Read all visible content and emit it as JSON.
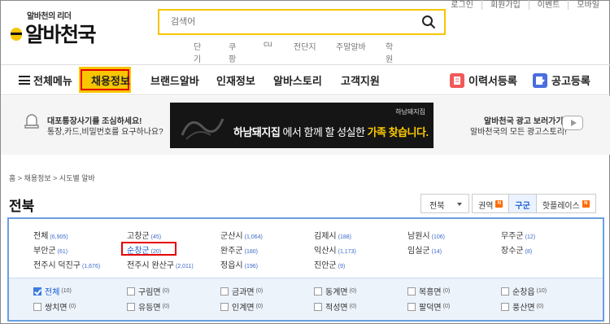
{
  "util": [
    "로그인",
    "회원가입",
    "이벤트",
    "모바일"
  ],
  "logo": {
    "tagline": "알바천의 리더",
    "name": "알바천국"
  },
  "search": {
    "placeholder": "검색어"
  },
  "keywords": [
    "단기",
    "쿠팡",
    "cu",
    "전단지",
    "주말알바",
    "학원"
  ],
  "nav": {
    "menu": "전체메뉴",
    "items": [
      "채용정보",
      "브랜드알바",
      "인재정보",
      "알바스토리",
      "고객지원"
    ],
    "resume": "이력서등록",
    "post": "공고등록"
  },
  "banner": {
    "warn1": "대포통장사기를 조심하세요!",
    "warn2": "통장,카드,비밀번호를 요구하나요?",
    "ad_brand": "하남돼지집",
    "ad_text_a": "하남돼지집",
    "ad_text_b": "에서 함께 할 성실한",
    "ad_text_c": "가족 찾습니다.",
    "promo1": "알바천국 광고 보러가기",
    "promo2": "알바천국의 모든 광고스토리!"
  },
  "breadcrumb": "홈 > 채용정보 > 시도별 알바",
  "title": "전북",
  "select": "전북",
  "tabs": [
    {
      "label": "권역",
      "badge": "N"
    },
    {
      "label": "구군",
      "badge": ""
    },
    {
      "label": "핫플레이스",
      "badge": "N"
    }
  ],
  "regions": [
    {
      "name": "전체",
      "count": "(6,905)"
    },
    {
      "name": "고창군",
      "count": "(45)"
    },
    {
      "name": "군산시",
      "count": "(1,064)"
    },
    {
      "name": "김제시",
      "count": "(188)"
    },
    {
      "name": "남원시",
      "count": "(106)"
    },
    {
      "name": "무주군",
      "count": "(12)"
    },
    {
      "name": "부안군",
      "count": "(61)"
    },
    {
      "name": "순창군",
      "count": "(20)"
    },
    {
      "name": "완주군",
      "count": "(180)"
    },
    {
      "name": "익산시",
      "count": "(1,173)"
    },
    {
      "name": "임실군",
      "count": "(14)"
    },
    {
      "name": "장수군",
      "count": "(8)"
    },
    {
      "name": "전주시 덕진구",
      "count": "(1,676)"
    },
    {
      "name": "전주시 완산구",
      "count": "(2,011)"
    },
    {
      "name": "정읍시",
      "count": "(196)"
    },
    {
      "name": "진안군",
      "count": "(9)"
    }
  ],
  "subregions": [
    {
      "name": "전체",
      "count": "(10)",
      "checked": true
    },
    {
      "name": "구림면",
      "count": "(0)",
      "checked": false
    },
    {
      "name": "금과면",
      "count": "(0)",
      "checked": false
    },
    {
      "name": "동계면",
      "count": "(0)",
      "checked": false
    },
    {
      "name": "복흥면",
      "count": "(0)",
      "checked": false
    },
    {
      "name": "순창읍",
      "count": "(10)",
      "checked": false
    },
    {
      "name": "쌍치면",
      "count": "(0)",
      "checked": false
    },
    {
      "name": "유등면",
      "count": "(0)",
      "checked": false
    },
    {
      "name": "인계면",
      "count": "(0)",
      "checked": false
    },
    {
      "name": "적성면",
      "count": "(0)",
      "checked": false
    },
    {
      "name": "팔덕면",
      "count": "(0)",
      "checked": false
    },
    {
      "name": "풍산면",
      "count": "(0)",
      "checked": false
    }
  ],
  "colors": {
    "brand": "#f7c600",
    "accent": "#1a5fd1",
    "highlight": "#e60000"
  }
}
